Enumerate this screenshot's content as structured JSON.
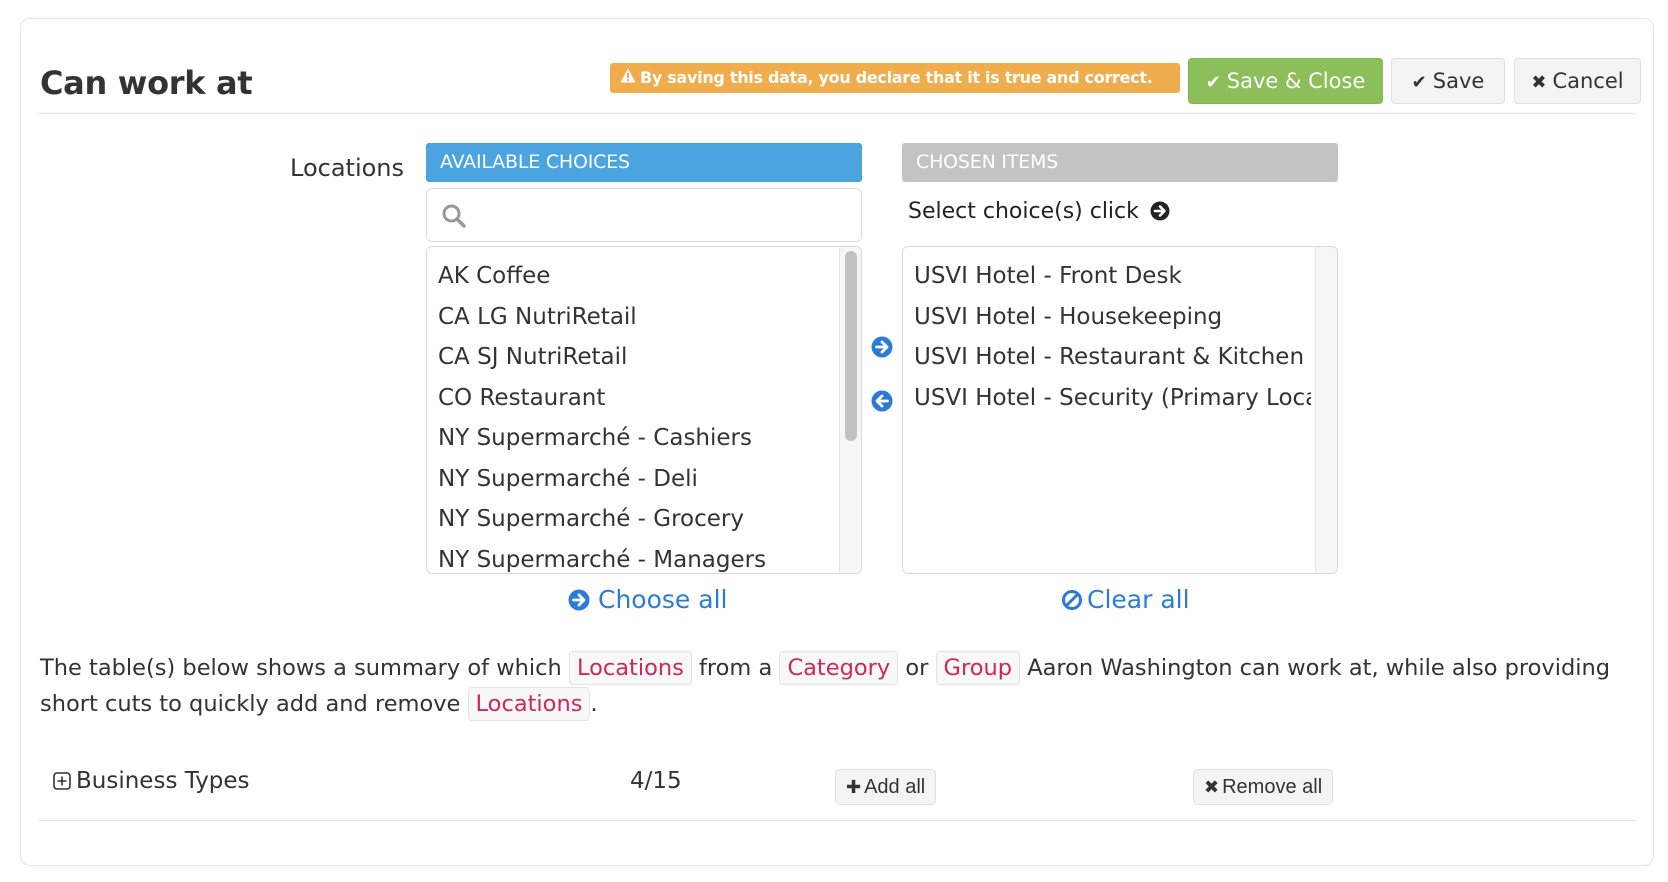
{
  "header": {
    "title": "Can work at",
    "warning": {
      "icon": "warning-triangle-icon",
      "text": "By saving this data, you declare that it is true and correct.",
      "color": "#f0ad4e"
    },
    "buttons": {
      "save_close": {
        "icon": "check-icon",
        "label": "Save & Close",
        "color": "#8cbf5a"
      },
      "save": {
        "icon": "check-icon",
        "label": "Save"
      },
      "cancel": {
        "icon": "times-icon",
        "label": "Cancel"
      }
    }
  },
  "locations": {
    "label": "Locations",
    "available": {
      "header": "AVAILABLE CHOICES",
      "header_color": "#4ba3e0",
      "search_placeholder": "",
      "search_value": "",
      "items": [
        "AK Coffee",
        "CA LG NutriRetail",
        "CA SJ NutriRetail",
        "CO Restaurant",
        "NY Supermarché - Cashiers",
        "NY Supermarché - Deli",
        "NY Supermarché - Grocery",
        "NY Supermarché - Managers"
      ]
    },
    "chosen": {
      "header": "CHOSEN ITEMS",
      "header_color": "#c3c3c3",
      "hint": "Select choice(s) click",
      "items": [
        "USVI Hotel - Front Desk",
        "USVI Hotel - Housekeeping",
        "USVI Hotel - Restaurant & Kitchen",
        "USVI Hotel - Security (Primary Location)"
      ]
    },
    "choose_all": "Choose all",
    "clear_all": "Clear all",
    "link_color": "#2e7bd6"
  },
  "summary": {
    "part1": "The table(s) below shows a summary of which ",
    "tag_locations": "Locations",
    "part2": " from a ",
    "tag_category": "Category",
    "part3": " or ",
    "tag_group": "Group",
    "part4": " Aaron Washington can work at, while also providing short cuts to quickly add and remove ",
    "tag_locations2": "Locations",
    "part5": ".",
    "tag_color": "#d0275a"
  },
  "table": {
    "rows": [
      {
        "label": "Business Types",
        "count": "4/15",
        "add_label": "Add all",
        "remove_label": "Remove all"
      }
    ]
  }
}
